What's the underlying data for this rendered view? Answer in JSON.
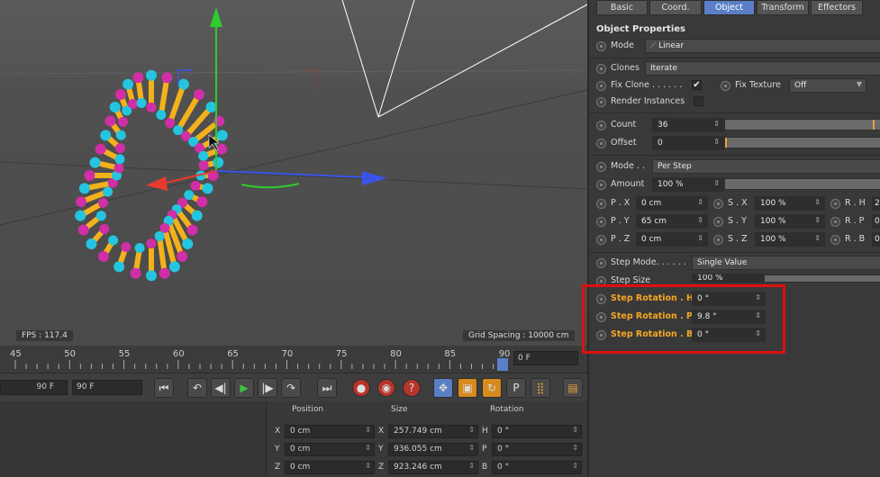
{
  "viewport": {
    "fps_label": "FPS : 117.4",
    "grid_spacing": "Grid Spacing : 10000 cm",
    "colors": {
      "bead_magenta": "#d02fa7",
      "bead_cyan": "#25c4e0",
      "rod_yellow": "#f3b21c",
      "axis_green": "#2ecc2e",
      "axis_red": "#e83a2c",
      "axis_blue": "#3a55e6"
    }
  },
  "timeline": {
    "ticks": [
      "45",
      "50",
      "55",
      "60",
      "65",
      "70",
      "75",
      "80",
      "85",
      "90"
    ],
    "current_frame": "0 F"
  },
  "transport": {
    "start_field": "90 F",
    "end_field": "90 F",
    "buttons": {
      "goto_start": "⏮",
      "prev_key": "↶",
      "step_back": "◀|",
      "play": "▶",
      "step_forward": "|▶",
      "next_key": "↷",
      "goto_end": "⏭",
      "record": "●",
      "autokey": "◉",
      "help": "?",
      "move": "✥",
      "scale": "▣",
      "rotate": "↻",
      "param": "P",
      "grid": "⣿",
      "film": "▤"
    }
  },
  "coords": {
    "headers": {
      "position": "Position",
      "size": "Size",
      "rotation": "Rotation"
    },
    "rows": [
      {
        "axis": "X",
        "pos": "0 cm",
        "size_axis": "X",
        "size": "257.749 cm",
        "rot_axis": "H",
        "rot": "0 °"
      },
      {
        "axis": "Y",
        "pos": "0 cm",
        "size_axis": "Y",
        "size": "936.055 cm",
        "rot_axis": "P",
        "rot": "0 °"
      },
      {
        "axis": "Z",
        "pos": "0 cm",
        "size_axis": "Z",
        "size": "923.246 cm",
        "rot_axis": "B",
        "rot": "0 °"
      }
    ]
  },
  "panel": {
    "tabs": [
      "Basic",
      "Coord.",
      "Object",
      "Transform",
      "Effectors"
    ],
    "title": "Object Properties",
    "mode_label": "Mode",
    "mode_value": "Linear",
    "clones_label": "Clones",
    "clones_value": "Iterate",
    "fix_clone_label": "Fix Clone . . . . . .",
    "fix_clone_checked": "✔",
    "fix_texture_label": "Fix Texture",
    "fix_texture_value": "Off",
    "render_instances_label": "Render Instances",
    "count_label": "Count",
    "count_value": "36",
    "offset_label": "Offset",
    "offset_value": "0",
    "mode2_label": "Mode . .",
    "mode2_value": "Per Step",
    "amount_label": "Amount",
    "amount_value": "100 %",
    "transform_rows": [
      {
        "p_label": "P . X",
        "p_val": "0 cm",
        "s_label": "S . X",
        "s_val": "100 %",
        "r_label": "R . H",
        "r_val": "2"
      },
      {
        "p_label": "P . Y",
        "p_val": "65 cm",
        "s_label": "S . Y",
        "s_val": "100 %",
        "r_label": "R . P",
        "r_val": "0"
      },
      {
        "p_label": "P . Z",
        "p_val": "0 cm",
        "s_label": "S . Z",
        "s_val": "100 %",
        "r_label": "R . B",
        "r_val": "0"
      }
    ],
    "step_mode_label": "Step Mode. . . . . .",
    "step_mode_value": "Single Value",
    "step_size_label": "Step Size",
    "step_size_value": "100 %",
    "step_rot": [
      {
        "label": "Step Rotation . H",
        "value": "0 °"
      },
      {
        "label": "Step Rotation . P",
        "value": "9.8 °"
      },
      {
        "label": "Step Rotation . B",
        "value": "0 °"
      }
    ],
    "highlight_color": "#e00f0f",
    "accent_color": "#5b7fc7",
    "label_highlight_color": "#f5a623"
  }
}
